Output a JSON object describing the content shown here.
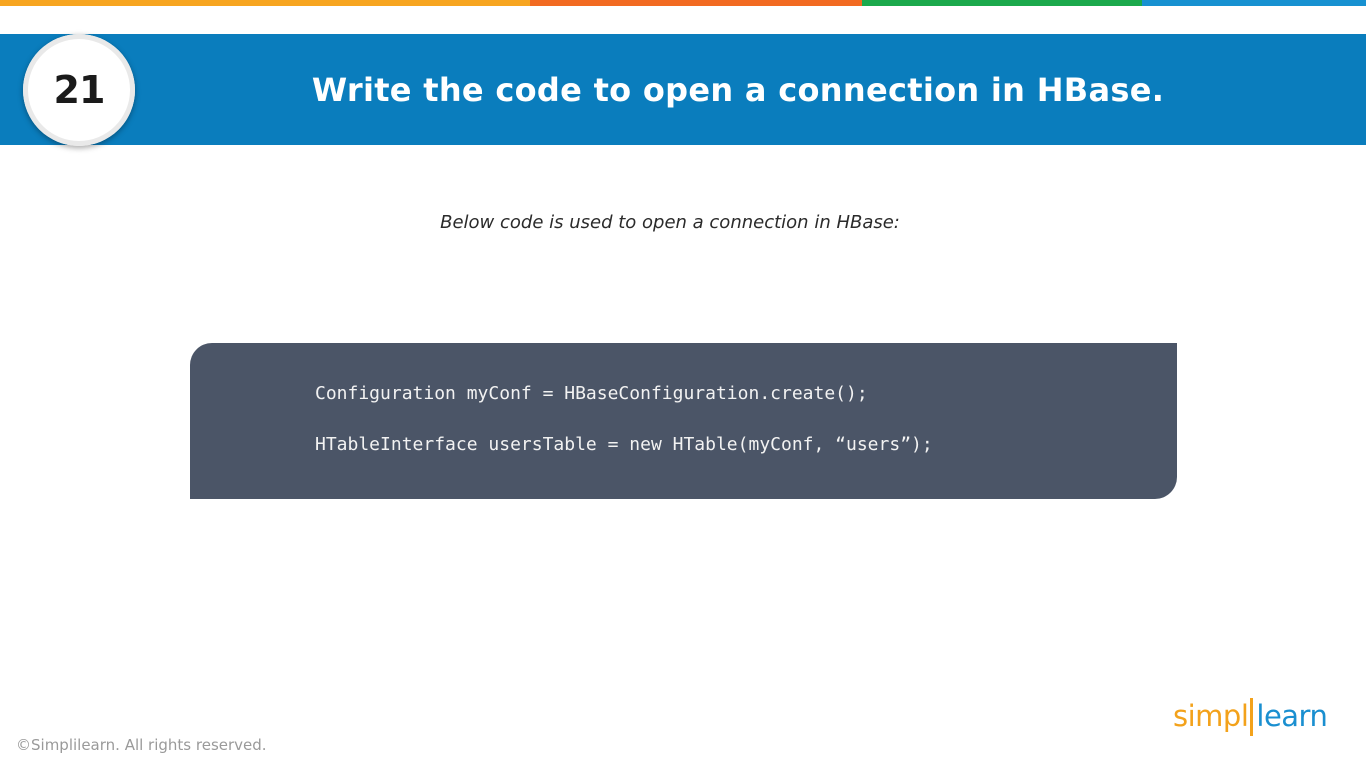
{
  "stripe_colors": [
    "#f7a520",
    "#f26a21",
    "#1ba94c",
    "#1791d1"
  ],
  "header": {
    "question_number": "21",
    "title": "Write the code to open a connection in HBase.",
    "band_color": "#0a7dbd"
  },
  "body": {
    "intro": "Below code is used to open a connection in HBase:",
    "code_lines": [
      "Configuration myConf = HBaseConfiguration.create();",
      "HTableInterface usersTable = new HTable(myConf, “users”);"
    ],
    "code_background": "#4b5567"
  },
  "footer": {
    "copyright": "©Simplilearn. All rights reserved.",
    "logo_part1": "simpl",
    "logo_part2": "learn"
  }
}
